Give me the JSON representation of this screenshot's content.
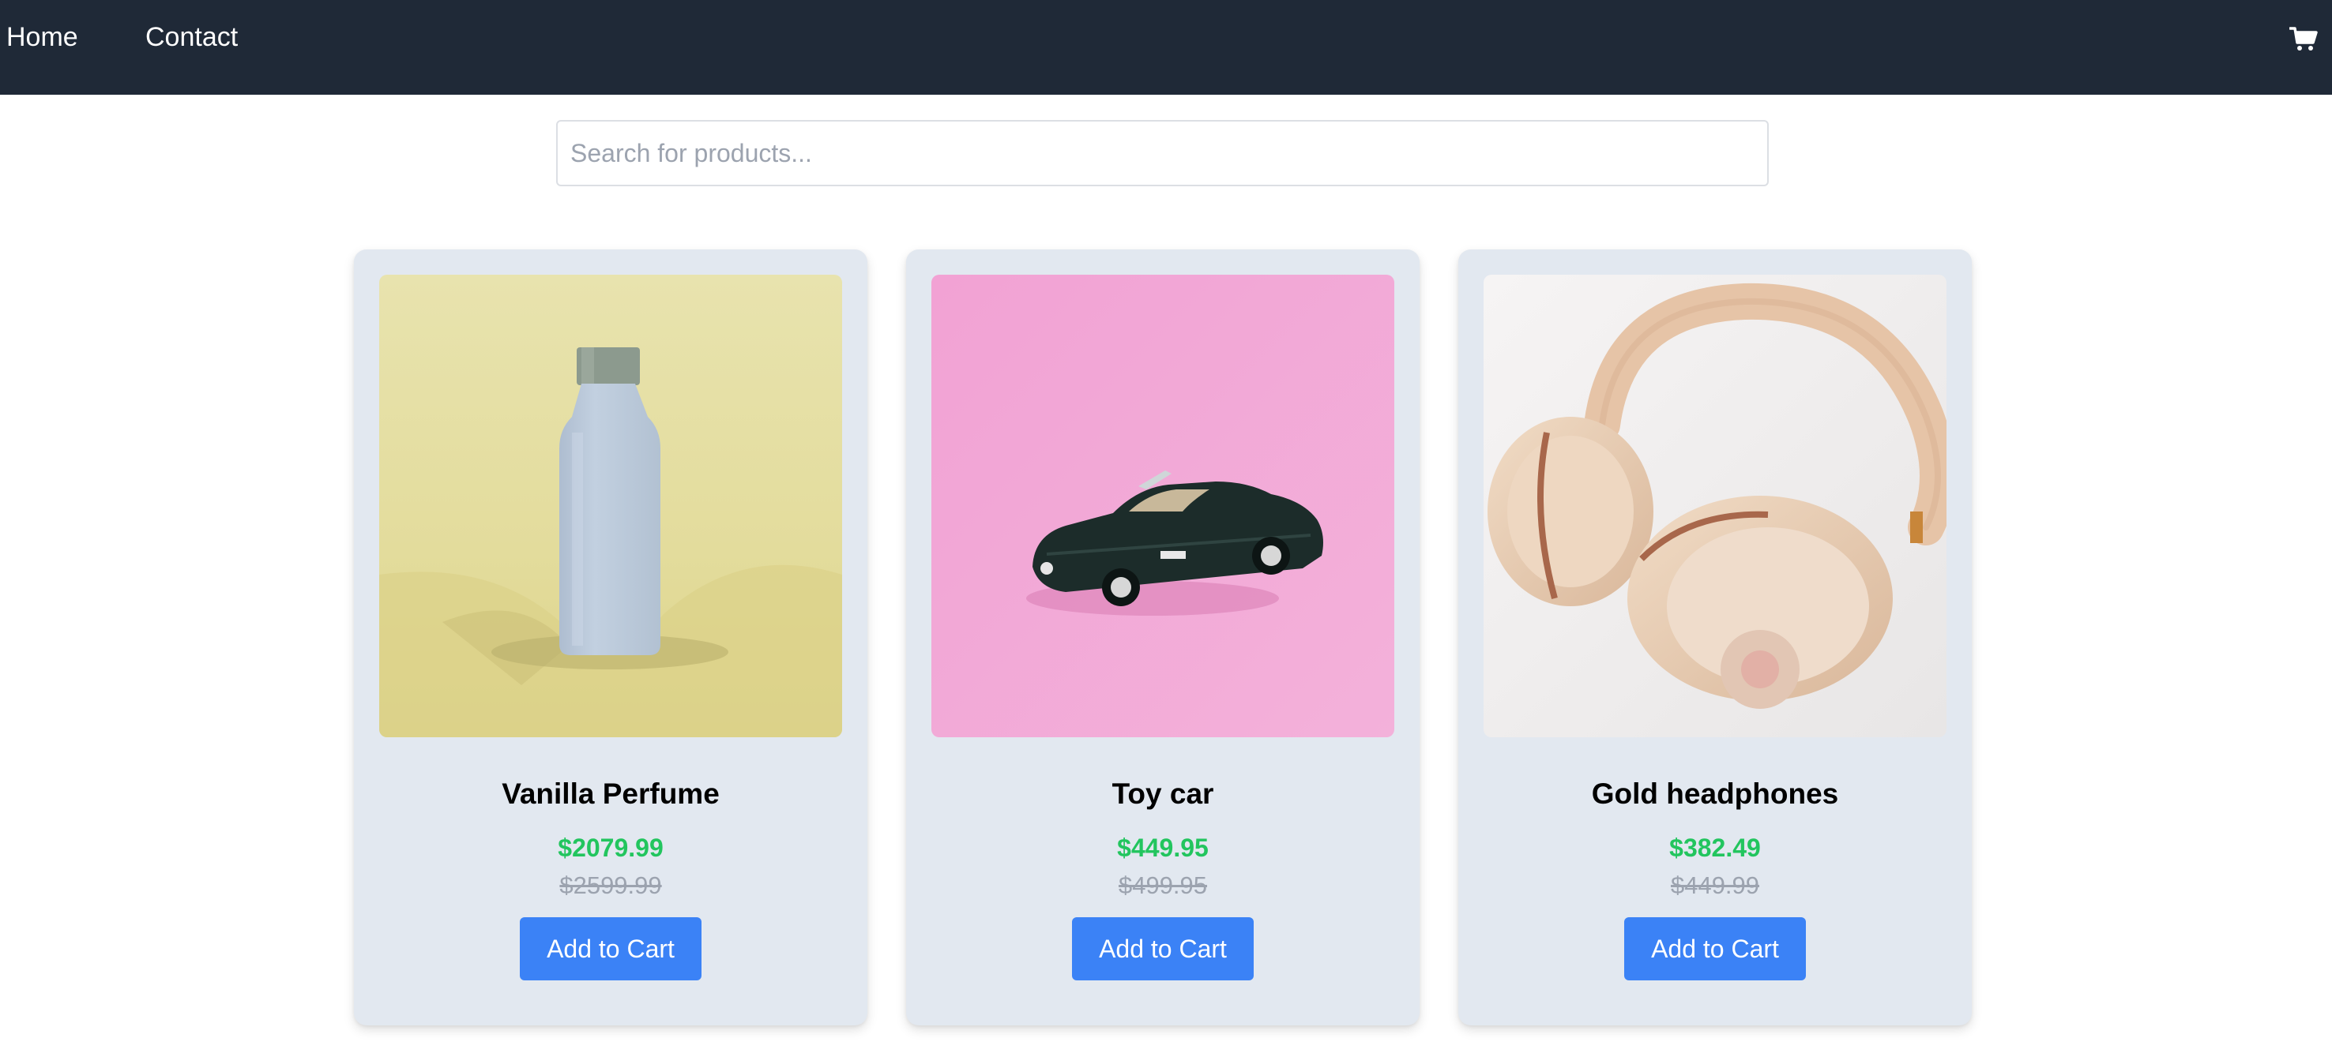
{
  "nav": {
    "home_label": "Home",
    "contact_label": "Contact",
    "cart_icon": "shopping-cart-icon"
  },
  "search": {
    "placeholder": "Search for products...",
    "value": ""
  },
  "products": [
    {
      "name": "Vanilla Perfume",
      "price": "$2079.99",
      "original_price": "$2599.99",
      "button_label": "Add to Cart",
      "image": "perfume-bottle-photo"
    },
    {
      "name": "Toy car",
      "price": "$449.95",
      "original_price": "$499.95",
      "button_label": "Add to Cart",
      "image": "toy-car-photo"
    },
    {
      "name": "Gold headphones",
      "price": "$382.49",
      "original_price": "$449.99",
      "button_label": "Add to Cart",
      "image": "headphones-photo"
    }
  ],
  "colors": {
    "navbar_bg": "#1f2937",
    "card_bg": "#e2e8f0",
    "price_green": "#22c55e",
    "old_price_gray": "#9ca3af",
    "button_blue": "#3b82f6"
  }
}
